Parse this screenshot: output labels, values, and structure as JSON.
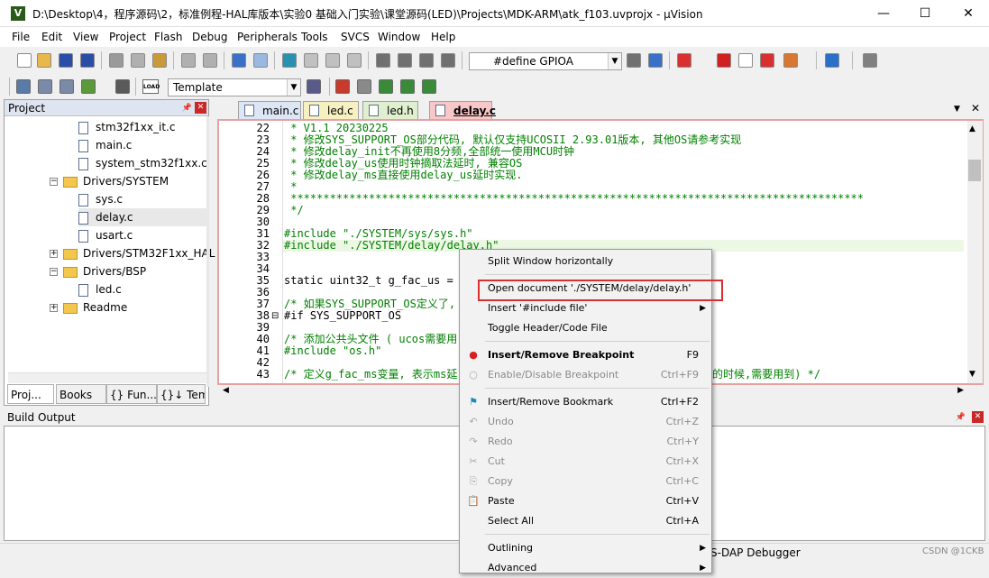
{
  "window": {
    "title": "D:\\Desktop\\4，程序源码\\2，标准例程-HAL库版本\\实验0 基础入门实验\\课堂源码(LED)\\Projects\\MDK-ARM\\atk_f103.uvprojx - µVision",
    "app_icon_letter": "V",
    "minimize": "—",
    "maximize": "☐",
    "close": "✕"
  },
  "menu": [
    "File",
    "Edit",
    "View",
    "Project",
    "Flash",
    "Debug",
    "Peripherals",
    "Tools",
    "SVCS",
    "Window",
    "Help"
  ],
  "toolbar1": {
    "define_combo": "#define GPIOA"
  },
  "toolbar2": {
    "target_combo": "Template",
    "load_label": "LOAD"
  },
  "project_panel": {
    "title": "Project",
    "items": [
      {
        "type": "file",
        "label": "stm32f1xx_it.c",
        "level": 2
      },
      {
        "type": "file",
        "label": "main.c",
        "level": 2
      },
      {
        "type": "file",
        "label": "system_stm32f1xx.c",
        "level": 2
      },
      {
        "type": "folder-open",
        "label": "Drivers/SYSTEM",
        "level": 1
      },
      {
        "type": "file",
        "label": "sys.c",
        "level": 2
      },
      {
        "type": "file",
        "label": "delay.c",
        "level": 2,
        "selected": true
      },
      {
        "type": "file",
        "label": "usart.c",
        "level": 2
      },
      {
        "type": "folder",
        "label": "Drivers/STM32F1xx_HAL",
        "level": 1
      },
      {
        "type": "folder-open",
        "label": "Drivers/BSP",
        "level": 1
      },
      {
        "type": "file",
        "label": "led.c",
        "level": 2
      },
      {
        "type": "folder",
        "label": "Readme",
        "level": 1
      }
    ],
    "tabs": [
      "Proj...",
      "Books",
      "{} Fun...",
      "{}↓ Tem..."
    ]
  },
  "editor_tabs": [
    {
      "label": "main.c",
      "active": false,
      "color": "#dce6f5"
    },
    {
      "label": "led.c",
      "active": false,
      "color": "#f7f0c0"
    },
    {
      "label": "led.h",
      "active": false,
      "color": "#e0efcf"
    },
    {
      "label": "delay.c",
      "active": true,
      "color": "#f8c8c8"
    }
  ],
  "code_lines": [
    {
      "n": "22",
      "t": " * V1.1 20230225",
      "kw": false
    },
    {
      "n": "23",
      "t": " * 修改SYS_SUPPORT_OS部分代码, 默认仅支持UCOSII 2.93.01版本, 其他OS请参考实现",
      "kw": false
    },
    {
      "n": "24",
      "t": " * 修改delay_init不再使用8分频,全部统一使用MCU时钟",
      "kw": false
    },
    {
      "n": "25",
      "t": " * 修改delay_us使用时钟摘取法延时, 兼容OS",
      "kw": false
    },
    {
      "n": "26",
      "t": " * 修改delay_ms直接使用delay_us延时实现.",
      "kw": false
    },
    {
      "n": "27",
      "t": " *",
      "kw": false
    },
    {
      "n": "28",
      "t": " ****************************************************************************************",
      "kw": false
    },
    {
      "n": "29",
      "t": " */",
      "kw": false
    },
    {
      "n": "30",
      "t": "",
      "kw": false
    },
    {
      "n": "31",
      "t": "#include \"./SYSTEM/sys/sys.h\"",
      "kw": false
    },
    {
      "n": "32",
      "t": "#include \"./SYSTEM/delay/delay.h\"",
      "kw": false
    },
    {
      "n": "33",
      "t": "",
      "kw": false
    },
    {
      "n": "34",
      "t": "",
      "kw": false
    },
    {
      "n": "35",
      "t": "static uint32_t g_fac_us = 0",
      "kw": true
    },
    {
      "n": "36",
      "t": "",
      "kw": false
    },
    {
      "n": "37",
      "t": "/* 如果SYS_SUPPORT_OS定义了,",
      "kw": false
    },
    {
      "n": "38",
      "t": "#if SYS_SUPPORT_OS",
      "kw": true
    },
    {
      "n": "39",
      "t": "",
      "kw": false
    },
    {
      "n": "40",
      "t": "/* 添加公共头文件 ( ucos需要用",
      "kw": false
    },
    {
      "n": "41",
      "t": "#include \"os.h\"",
      "kw": false
    },
    {
      "n": "42",
      "t": "",
      "kw": false
    },
    {
      "n": "43",
      "t": "/* 定义g_fac_ms变量, 表示ms延",
      "kw": false
    }
  ],
  "code_line43_tail": "的时候,需要用到) */",
  "build_output": {
    "title": "Build Output"
  },
  "status_bar": {
    "debugger": "S-DAP Debugger",
    "watermark": "CSDN @1CKB"
  },
  "context_menu": {
    "items": [
      {
        "label": "Split Window horizontally",
        "shortcut": "",
        "disabled": false,
        "icon": "",
        "bold": false
      },
      {
        "sep": true
      },
      {
        "label": "Open document './SYSTEM/delay/delay.h'",
        "shortcut": "",
        "disabled": false,
        "icon": "",
        "bold": false,
        "highlighted": true
      },
      {
        "label": "Insert '#include file'",
        "shortcut": "▶",
        "disabled": false,
        "icon": "",
        "bold": false
      },
      {
        "label": "Toggle Header/Code File",
        "shortcut": "",
        "disabled": false,
        "icon": "",
        "bold": false
      },
      {
        "sep": true
      },
      {
        "label": "Insert/Remove Breakpoint",
        "shortcut": "F9",
        "disabled": false,
        "icon": "●",
        "iconColor": "#d92020",
        "bold": true
      },
      {
        "label": "Enable/Disable Breakpoint",
        "shortcut": "Ctrl+F9",
        "disabled": true,
        "icon": "○",
        "iconColor": "#aaaaaa",
        "bold": false
      },
      {
        "sep": true
      },
      {
        "label": "Insert/Remove Bookmark",
        "shortcut": "Ctrl+F2",
        "disabled": false,
        "icon": "⚑",
        "iconColor": "#1a8ab8",
        "bold": false
      },
      {
        "label": "Undo",
        "shortcut": "Ctrl+Z",
        "disabled": true,
        "icon": "↶",
        "iconColor": "#aaaaaa",
        "bold": false
      },
      {
        "label": "Redo",
        "shortcut": "Ctrl+Y",
        "disabled": true,
        "icon": "↷",
        "iconColor": "#aaaaaa",
        "bold": false
      },
      {
        "label": "Cut",
        "shortcut": "Ctrl+X",
        "disabled": true,
        "icon": "✂",
        "iconColor": "#aaaaaa",
        "bold": false
      },
      {
        "label": "Copy",
        "shortcut": "Ctrl+C",
        "disabled": true,
        "icon": "⎘",
        "iconColor": "#aaaaaa",
        "bold": false
      },
      {
        "label": "Paste",
        "shortcut": "Ctrl+V",
        "disabled": false,
        "icon": "📋",
        "iconColor": "#a87a20",
        "bold": false
      },
      {
        "label": "Select All",
        "shortcut": "Ctrl+A",
        "disabled": false,
        "icon": "",
        "bold": false
      },
      {
        "sep": true
      },
      {
        "label": "Outlining",
        "shortcut": "▶",
        "disabled": false,
        "icon": "",
        "bold": false
      },
      {
        "label": "Advanced",
        "shortcut": "▶",
        "disabled": false,
        "icon": "",
        "bold": false
      }
    ]
  }
}
